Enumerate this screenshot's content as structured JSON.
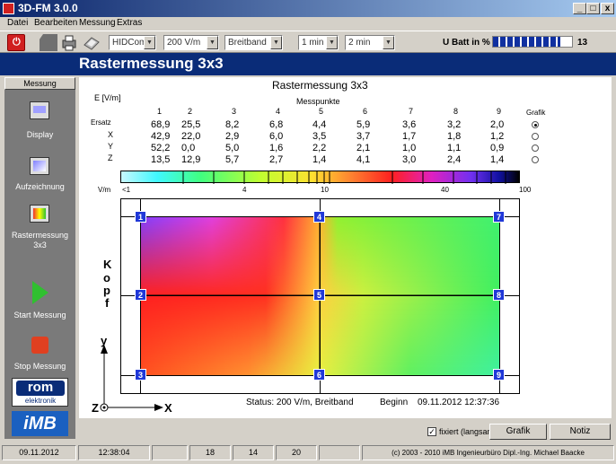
{
  "window": {
    "title": "3D-FM 3.0.0",
    "min": "_",
    "max": "□",
    "close": "x"
  },
  "menu": [
    "Datei",
    "Bearbeiten",
    "Messung",
    "Extras"
  ],
  "toolbar": {
    "port": "HIDCom",
    "range": "200 V/m",
    "band": "Breitband",
    "t1": "1 min",
    "t2": "2 min",
    "batt_label": "U Batt in %",
    "batt_value": "13",
    "batt_fill": 0.85
  },
  "header": "Rastermessung 3x3",
  "sidebar": {
    "tab": "Messung",
    "items": [
      "Display",
      "Aufzeichnung",
      "Rastermessung 3x3",
      "Start Messung",
      "Stop Messung"
    ],
    "logo1a": "rom",
    "logo1b": "elektronik",
    "logo2": "iMB"
  },
  "main": {
    "title": "Rastermessung 3x3",
    "unit": "E [V/m]",
    "messpunkte": "Messpunkte",
    "grafik": "Grafik",
    "cols": [
      "1",
      "2",
      "3",
      "4",
      "5",
      "6",
      "7",
      "8",
      "9"
    ],
    "rows": [
      {
        "label": "Ersatz",
        "values": [
          "68,9",
          "25,5",
          "8,2",
          "6,8",
          "4,4",
          "5,9",
          "3,6",
          "3,2",
          "2,0"
        ],
        "selected": true
      },
      {
        "label": "X",
        "values": [
          "42,9",
          "22,0",
          "2,9",
          "6,0",
          "3,5",
          "3,7",
          "1,7",
          "1,8",
          "1,2"
        ],
        "selected": false
      },
      {
        "label": "Y",
        "values": [
          "52,2",
          "0,0",
          "5,0",
          "1,6",
          "2,2",
          "2,1",
          "1,0",
          "1,1",
          "0,9"
        ],
        "selected": false
      },
      {
        "label": "Z",
        "values": [
          "13,5",
          "12,9",
          "5,7",
          "2,7",
          "1,4",
          "4,1",
          "3,0",
          "2,4",
          "1,4"
        ],
        "selected": false
      }
    ],
    "scale": {
      "unit": "V/m",
      "ticks": [
        "<1",
        "4",
        "10",
        "40",
        "100"
      ]
    },
    "points": [
      "1",
      "2",
      "3",
      "4",
      "5",
      "6",
      "7",
      "8",
      "9"
    ],
    "kopf": [
      "K",
      "o",
      "p",
      "f"
    ],
    "axes": {
      "y": "y",
      "z": "Z",
      "x": "X"
    },
    "status": "Status:  200 V/m, Breitband",
    "beginn_label": "Beginn",
    "beginn": "09.11.2012 12:37:36"
  },
  "controls": {
    "fixiert": "fixiert (langsam)",
    "fixiert_checked": true,
    "grafik": "Grafik",
    "notiz": "Notiz"
  },
  "statusbar": {
    "date": "09.11.2012",
    "time": "12:38:04",
    "n1": "18",
    "n2": "14",
    "n3": "20",
    "copyright": "(c) 2003 - 2010  iMB  Ingenieurbüro Dipl.-Ing. Michael Baacke"
  }
}
